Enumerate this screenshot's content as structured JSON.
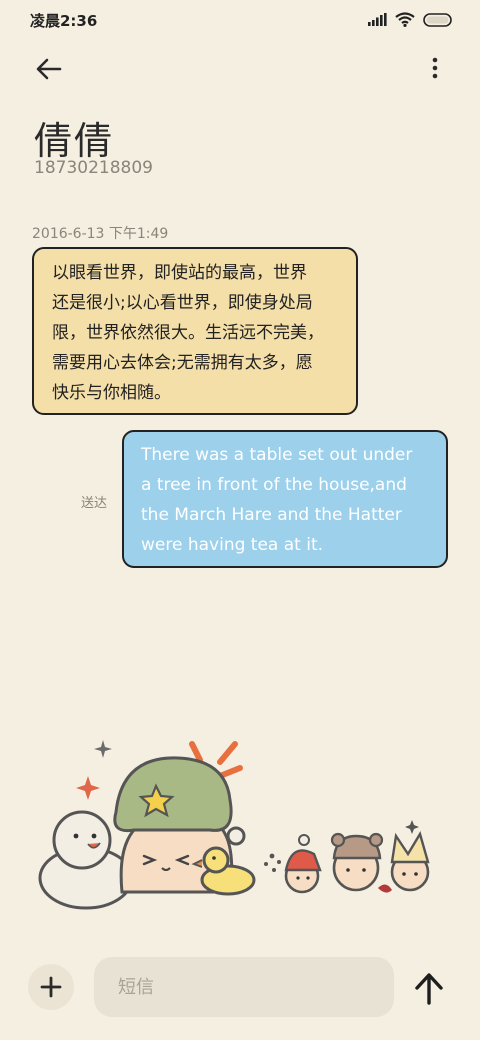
{
  "status_bar": {
    "time": "凌晨2:36",
    "icons": [
      "signal-icon",
      "wifi-icon",
      "battery-icon"
    ]
  },
  "header": {
    "back_icon": "back-arrow-icon",
    "more_icon": "more-vertical-icon",
    "contact_name": "倩倩",
    "contact_number": "18730218809"
  },
  "conversation": {
    "timestamp": "2016-6-13 下午1:49",
    "incoming": {
      "lines": [
        "以眼看世界，即使站的最高，世界",
        "还是很小;以心看世界，即使身处局",
        "限，世界依然很大。生活远不完美，",
        "需要用心去体会;无需拥有太多，愿",
        "快乐与你相随。"
      ]
    },
    "outgoing": {
      "lines": [
        "There was a table set out under",
        "a tree in front of the house,and",
        "the March Hare and the Hatter",
        "were having tea at it."
      ],
      "status": "送达"
    }
  },
  "composer": {
    "add_icon": "plus-icon",
    "placeholder": "短信",
    "send_icon": "send-arrow-icon"
  },
  "colors": {
    "background": "#f5efe1",
    "incoming_bubble": "#f4dfa8",
    "outgoing_bubble": "#9cd0eb",
    "bubble_border": "#222222"
  }
}
